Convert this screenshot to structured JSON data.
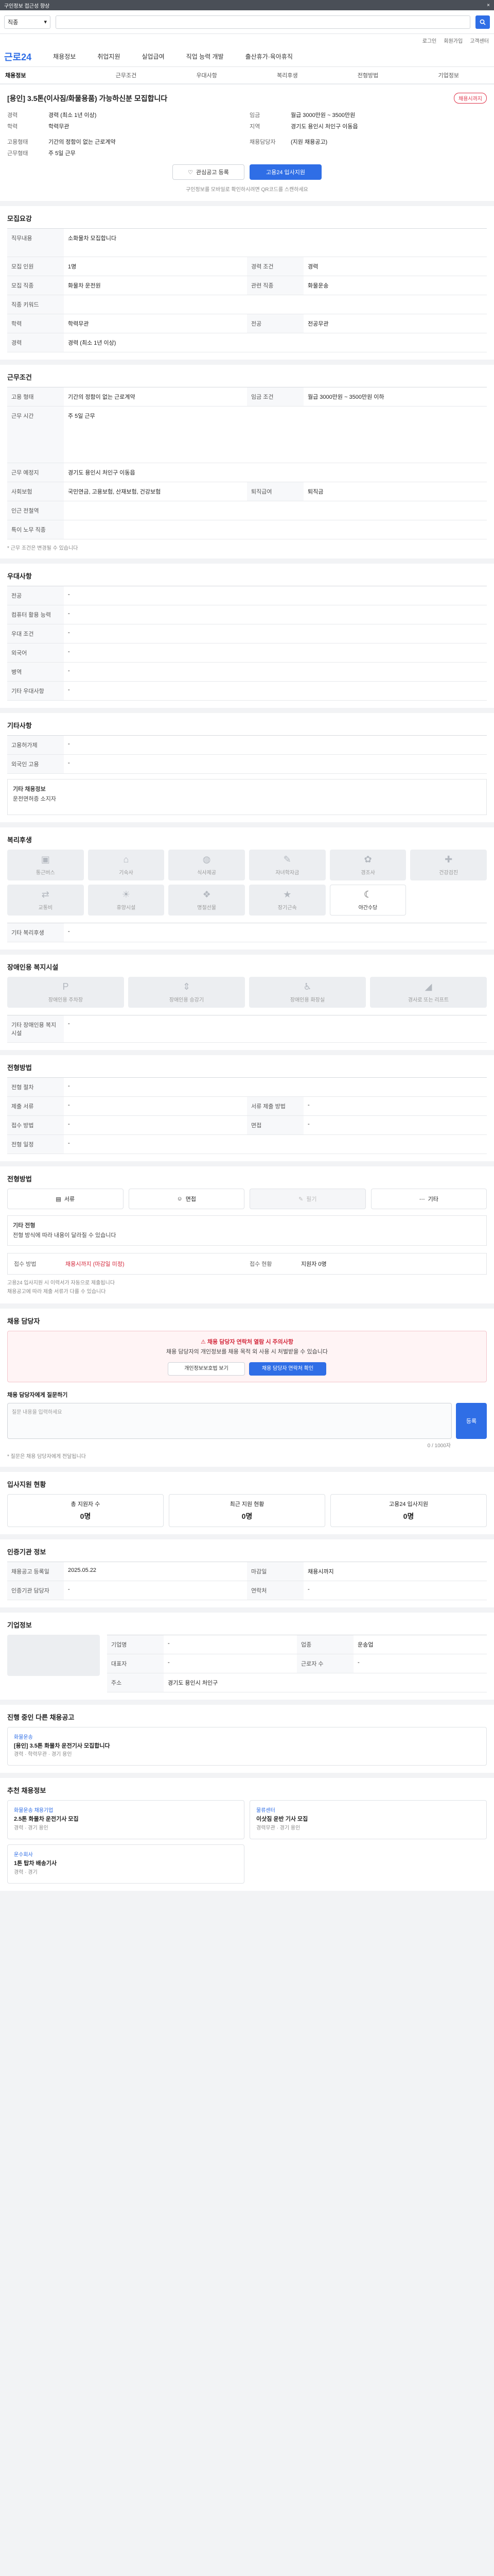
{
  "topbar": {
    "text": "구인정보 접근성 향상",
    "close": "×"
  },
  "search": {
    "select": "직종",
    "placeholder": "",
    "button": "검색"
  },
  "util": [
    "로그인",
    "회원가입",
    "고객센터"
  ],
  "gnb": {
    "logo": "근로24",
    "items": [
      "채용정보",
      "취업지원",
      "실업급여",
      "직업 능력 개발",
      "출산휴가·육아휴직"
    ]
  },
  "tabs": [
    "채용정보",
    "근무조건",
    "우대사항",
    "복리후생",
    "전형방법",
    "기업정보"
  ],
  "job": {
    "title": "[용인] 3.5톤(이사짐/화물용품) 가능하신분 모집합니다",
    "badge": "채용시까지",
    "org_label": "기업정보",
    "rows": [
      {
        "k": "경력",
        "v": "경력 (최소 1년 이상)"
      },
      {
        "k": "임금",
        "v": "월급 3000만원 ~ 3500만원"
      },
      {
        "k": "학력",
        "v": "학력무관"
      },
      {
        "k": "지역",
        "v": "경기도 용인시 처인구 이동읍"
      },
      {
        "k": "고용형태",
        "v": "기간의 정함이 없는 근로계약"
      },
      {
        "k": "근무형태",
        "v": "주 5일 근무"
      }
    ],
    "apply_info": "채용담당자",
    "apply_v": "(지원 채용공고)",
    "save_button": "관심공고 등록",
    "apply_button": "고용24 입사지원",
    "note": "구인정보를 모바일로 확인하시려면 QR코드를 스캔하세요"
  },
  "sec_recruit": {
    "h": "모집요강",
    "duty_k": "직무내용",
    "duty_v": "소화물차 모집합니다",
    "rows": [
      [
        "모집 인원",
        "1명",
        "경력 조건",
        "경력"
      ],
      [
        "모집 직종",
        "화물차 운전원",
        "관련 직종",
        "화물운송"
      ],
      [
        "직종 키워드",
        "",
        "",
        ""
      ],
      [
        "학력",
        "학력무관",
        "전공",
        "전공무관"
      ],
      [
        "경력",
        "경력 (최소 1년 이상)",
        "",
        ""
      ]
    ]
  },
  "sec_condition": {
    "h": "근무조건",
    "rows": [
      [
        "고용 형태",
        "기간의 정함이 없는 근로계약",
        "임금 조건",
        "월급 3000만원 ~ 3500만원 이하"
      ],
      [
        "근무 시간",
        "주 5일 근무",
        "",
        ""
      ],
      [
        "근무 예정지",
        "경기도 용인시 처인구 이동읍",
        "",
        ""
      ],
      [
        "사회보험",
        "국민연금, 고용보험, 산재보험, 건강보험",
        "퇴직급여",
        "퇴직금"
      ],
      [
        "인근 전철역",
        "",
        "",
        ""
      ],
      [
        "특이 노무 직종",
        "",
        "",
        ""
      ]
    ],
    "note": "* 근무 조건은 변경될 수 있습니다"
  },
  "sec_pref": {
    "h": "우대사항",
    "rows": [
      [
        "전공",
        "-"
      ],
      [
        "컴퓨터 활용 능력",
        "-"
      ],
      [
        "우대 조건",
        "-"
      ],
      [
        "외국어",
        "-"
      ],
      [
        "병역",
        "-"
      ],
      [
        "기타 우대사항",
        "-"
      ]
    ]
  },
  "sec_etc": {
    "h": "기타사항",
    "rows": [
      [
        "고용허가제",
        "-"
      ],
      [
        "외국인 고용",
        "-"
      ]
    ],
    "box_k": "기타 채용정보",
    "box_v": "운전면허증 소지자"
  },
  "sec_welfare": {
    "h": "복리후생",
    "items": [
      "통근버스",
      "기숙사",
      "식사제공",
      "자녀학자금",
      "경조사",
      "건강검진",
      "교통비",
      "휴양시설",
      "명절선물",
      "장기근속",
      "야간수당"
    ],
    "etc_k": "기타 복리후생",
    "etc_v": "-"
  },
  "sec_disab": {
    "h": "장애인용 복지시설",
    "items": [
      "장애인용 주차장",
      "장애인용 승강기",
      "장애인용 화장실",
      "경사로 또는 리프트"
    ],
    "etc_k": "기타 장애인용 복지시설",
    "etc_v": "-"
  },
  "sec_process": {
    "h": "전형방법",
    "rows": [
      [
        "전형 절차",
        "-"
      ],
      [
        "제출 서류",
        "-",
        "서류 제출 방법",
        "-"
      ],
      [
        "접수 방법",
        "-",
        "면접",
        "-"
      ],
      [
        "전형 일정",
        "-",
        "",
        ""
      ]
    ]
  },
  "sec_method": {
    "h": "전형방법",
    "items": [
      "서류",
      "면접",
      "필기",
      "기타"
    ],
    "note_k": "기타 전형",
    "note_v": "전형 방식에 따라 내용이 달라질 수 있습니다"
  },
  "sec_apply": {
    "k1": "접수 방법",
    "v1": "채용시까지 (마감일 미정)",
    "k2": "접수 현황",
    "v2": "지원자 0명",
    "notes": [
      "고용24 입사지원 시 이력서가 자동으로 제출됩니다",
      "채용공고에 따라 제출 서류가 다를 수 있습니다"
    ]
  },
  "sec_contact": {
    "h": "채용 담당자",
    "alert_h": "채용 담당자 연락처 열람 시 주의사항",
    "alert_v": "채용 담당자의 개인정보를 채용 목적 외 사용 시 처벌받을 수 있습니다",
    "btn1": "개인정보보호법 보기",
    "btn2": "채용 담당자 연락처 확인",
    "q_h": "채용 담당자에게 질문하기",
    "q_placeholder": "질문 내용을 입력하세요",
    "q_count": "0 / 1000자",
    "q_button": "등록",
    "notes": [
      "* 질문은 채용 담당자에게 전달됩니다"
    ]
  },
  "sec_stats": {
    "h": "입사지원 현황",
    "items": [
      {
        "k": "총 지원자 수",
        "v": "0명"
      },
      {
        "k": "최근 지원 현황",
        "v": "0명"
      },
      {
        "k": "고용24 입사지원",
        "v": "0명"
      }
    ]
  },
  "sec_info": {
    "h": "인증기관 정보",
    "rows": [
      [
        "채용공고 등록일",
        "2025.05.22",
        "마감일",
        "채용시까지"
      ],
      [
        "인증기관 담당자",
        "-",
        "연락처",
        "-"
      ]
    ]
  },
  "sec_company": {
    "h": "기업정보",
    "rows": [
      [
        "기업명",
        "-",
        "업종",
        "운송업"
      ],
      [
        "대표자",
        "-",
        "근로자 수",
        "-"
      ],
      [
        "주소",
        "경기도 용인시 처인구",
        "",
        ""
      ]
    ]
  },
  "sec_other": {
    "h": "진행 중인 다른 채용공고",
    "job_title": "[용인] 3.5톤 화물차 운전기사 모집합니다",
    "job_org": "화물운송",
    "job_meta": "경력 · 학력무관 · 경기 용인"
  },
  "sec_recommend": {
    "h": "추천 채용정보",
    "cards": [
      {
        "org": "화물운송 채용기업",
        "t": "2.5톤 화물차 운전기사 모집",
        "m": "경력 · 경기 용인"
      },
      {
        "org": "물류센터",
        "t": "이삿짐 운반 기사 모집",
        "m": "경력무관 · 경기 용인"
      },
      {
        "org": "운수회사",
        "t": "1톤 탑차 배송기사",
        "m": "경력 · 경기"
      }
    ]
  }
}
